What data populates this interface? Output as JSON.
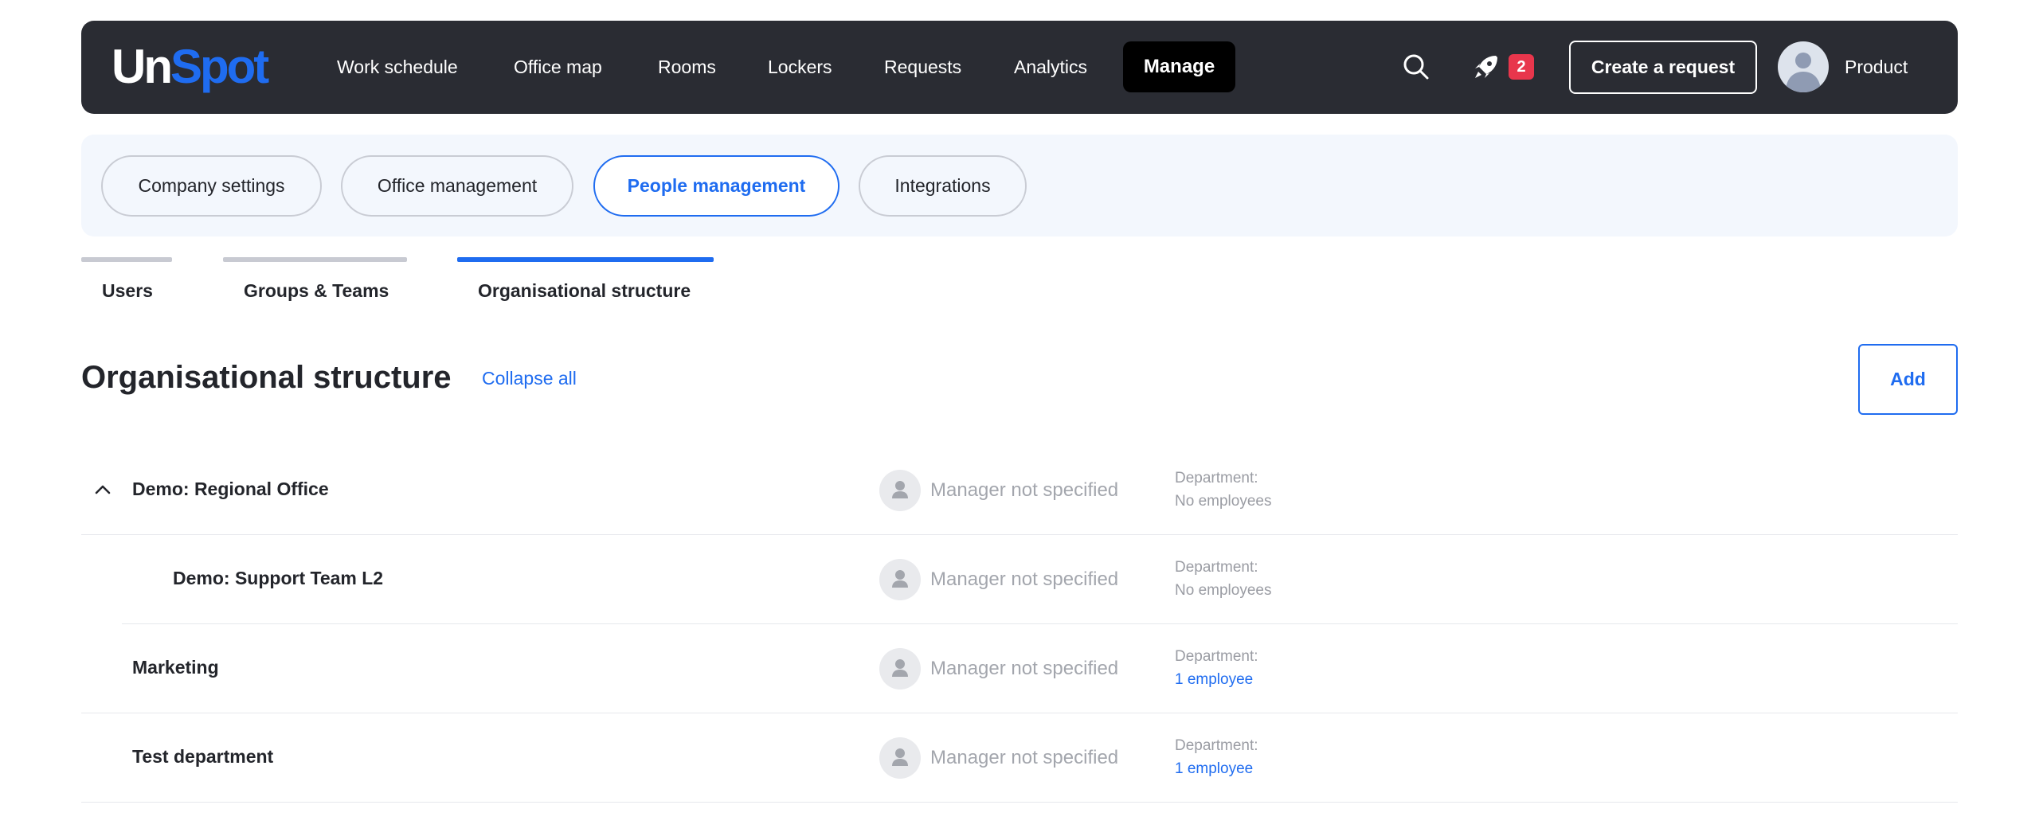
{
  "brand": {
    "logo_part1": "Un",
    "logo_part2": "Spot"
  },
  "topnav": {
    "items": [
      "Work schedule",
      "Office map",
      "Rooms",
      "Lockers",
      "Requests",
      "Analytics"
    ],
    "active_item": "Manage",
    "notification_count": "2",
    "create_request_label": "Create a request",
    "profile_name": "Product",
    "icons": [
      "search-icon",
      "rocket-icon",
      "avatar"
    ]
  },
  "section_tabs": {
    "items": [
      "Company settings",
      "Office management",
      "People management",
      "Integrations"
    ],
    "active": "People management"
  },
  "sub_tabs": {
    "items": [
      "Users",
      "Groups & Teams",
      "Organisational structure"
    ],
    "active": "Organisational structure"
  },
  "page": {
    "title": "Organisational structure",
    "collapse_label": "Collapse all",
    "add_label": "Add"
  },
  "departments": [
    {
      "name": "Demo: Regional Office",
      "manager": "Manager not specified",
      "dept_label": "Department:",
      "employees": "No employees",
      "expanded": true,
      "level": 0
    },
    {
      "name": "Demo: Support Team L2",
      "manager": "Manager not specified",
      "dept_label": "Department:",
      "employees": "No employees",
      "level": 1
    },
    {
      "name": "Marketing",
      "manager": "Manager not specified",
      "dept_label": "Department:",
      "employees": "1 employee",
      "level": 0
    },
    {
      "name": "Test department",
      "manager": "Manager not specified",
      "dept_label": "Department:",
      "employees": "1 employee",
      "level": 0
    }
  ],
  "colors": {
    "accent": "#1f6cf0",
    "topbar": "#2a2c33",
    "badge": "#e8364c",
    "section_bg": "#f3f7fd"
  }
}
